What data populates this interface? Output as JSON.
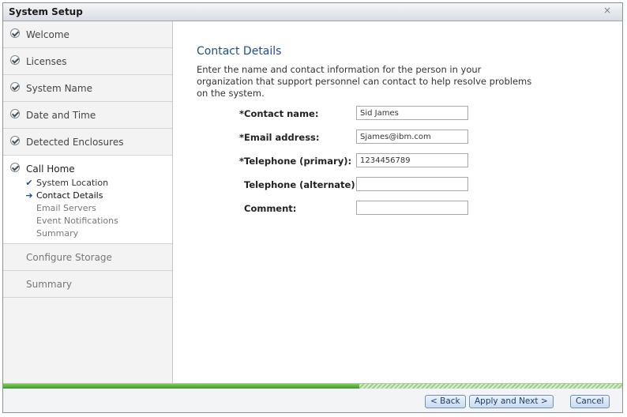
{
  "window": {
    "title": "System Setup",
    "close_glyph": "×"
  },
  "sidebar": {
    "completed_steps": [
      {
        "label": "Welcome"
      },
      {
        "label": "Licenses"
      },
      {
        "label": "System Name"
      },
      {
        "label": "Date and Time"
      },
      {
        "label": "Detected Enclosures"
      }
    ],
    "current_step": {
      "label": "Call Home",
      "substeps": [
        {
          "label": "System Location",
          "state": "done",
          "mark": "✔"
        },
        {
          "label": "Contact Details",
          "state": "active",
          "mark": "➔"
        },
        {
          "label": "Email Servers",
          "state": "pending",
          "mark": ""
        },
        {
          "label": "Event Notifications",
          "state": "pending",
          "mark": ""
        },
        {
          "label": "Summary",
          "state": "pending",
          "mark": ""
        }
      ]
    },
    "pending_steps": [
      {
        "label": "Configure Storage"
      },
      {
        "label": "Summary"
      }
    ]
  },
  "main": {
    "heading": "Contact Details",
    "intro": "Enter the name and contact information for the person in your organization that support personnel can contact to help resolve problems on the system.",
    "fields": [
      {
        "label": "*Contact name:",
        "value": "Sid James"
      },
      {
        "label": "*Email address:",
        "value": "Sjames@ibm.com"
      },
      {
        "label": "*Telephone (primary):",
        "value": "1234456789"
      },
      {
        "label": "Telephone (alternate):",
        "value": ""
      },
      {
        "label": "Comment:",
        "value": ""
      }
    ]
  },
  "progress": {
    "fraction": 0.575
  },
  "footer": {
    "back_label": "< Back",
    "apply_next_label": "Apply and Next >",
    "cancel_label": "Cancel"
  },
  "colors": {
    "heading": "#1c4f8c",
    "progress_green": "#3f9a2a",
    "button_border": "#6f8fb5"
  },
  "icons": {
    "completed_step": "check-circle-icon",
    "substep_done": "checkmark-icon",
    "substep_active": "arrow-right-icon",
    "window_close": "close-icon"
  }
}
